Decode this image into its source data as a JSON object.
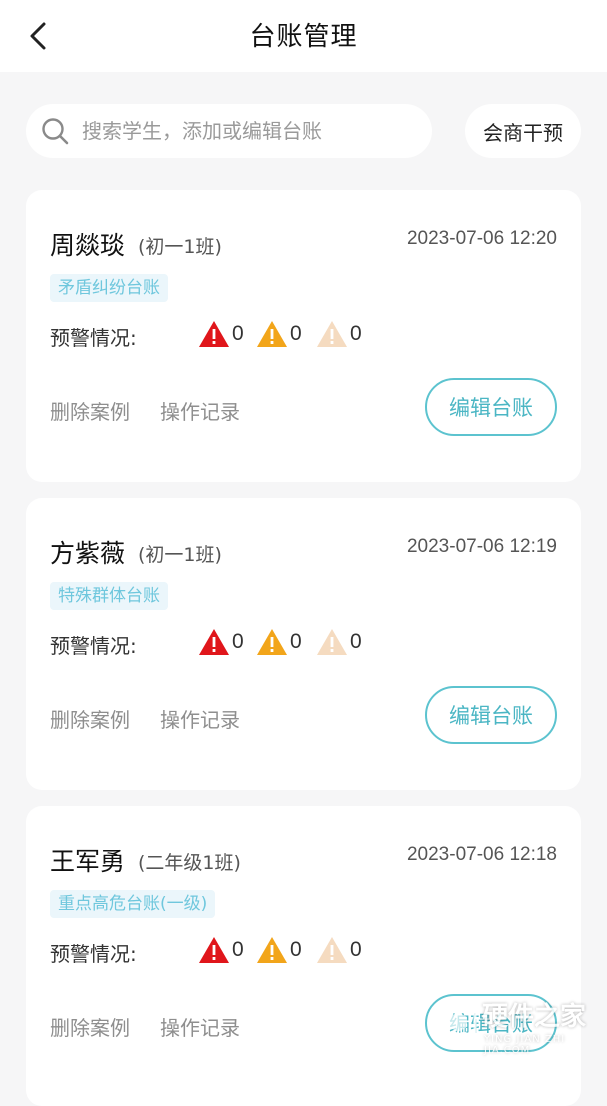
{
  "header": {
    "title": "台账管理",
    "back_icon": "chevron-left-icon"
  },
  "search": {
    "placeholder": "搜索学生，添加或编辑台账",
    "value": "",
    "icon": "search-icon"
  },
  "consult_button": "会商干预",
  "warning_label": "预警情况:",
  "delete_label": "删除案例",
  "history_label": "操作记录",
  "edit_label": "编辑台账",
  "warning_colors": {
    "high": "#e0161b",
    "medium": "#f2a51a",
    "low": "#f5dbc0"
  },
  "records": [
    {
      "name": "周燚琰",
      "class": "(初一1班)",
      "time": "2023-07-06 12:20",
      "tag": "矛盾纠纷台账",
      "warnings": {
        "high": "0",
        "medium": "0",
        "low": "0"
      }
    },
    {
      "name": "方紫薇",
      "class": "(初一1班)",
      "time": "2023-07-06 12:19",
      "tag": "特殊群体台账",
      "warnings": {
        "high": "0",
        "medium": "0",
        "low": "0"
      }
    },
    {
      "name": "王军勇",
      "class": "(二年级1班)",
      "time": "2023-07-06 12:18",
      "tag": "重点高危台账(一级)",
      "warnings": {
        "high": "0",
        "medium": "0",
        "low": "0"
      }
    }
  ],
  "watermark": {
    "text": "硬件之家",
    "sub": "YING JIAN ZHI JIA.COM"
  }
}
